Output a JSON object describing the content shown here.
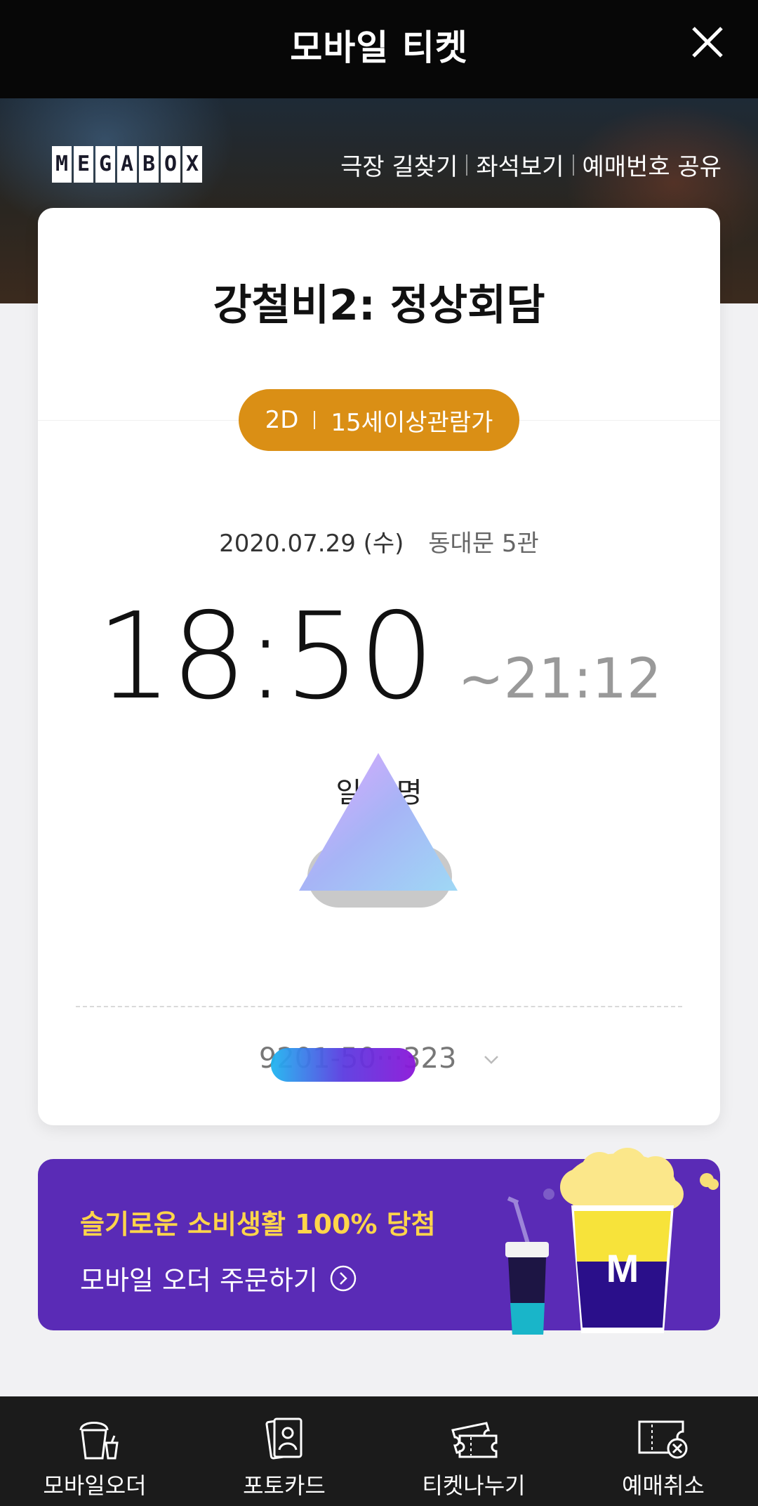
{
  "header": {
    "title": "모바일 티켓"
  },
  "hero": {
    "logo_letters": [
      "M",
      "E",
      "G",
      "A",
      "B",
      "O",
      "X"
    ],
    "links": [
      "극장 길찾기",
      "좌석보기",
      "예매번호 공유"
    ]
  },
  "ticket": {
    "movie_title": "강철비2: 정상회담",
    "format": "2D",
    "rating": "15세이상관람가",
    "date": "2020.07.29 (수)",
    "theater": "동대문 5관",
    "start_time": "18:50",
    "end_time": "~21:12",
    "people_label": "일반 명",
    "booking_number": "9201-50···323"
  },
  "promo": {
    "line1": "슬기로운 소비생활 100% 당첨",
    "line2": "모바일 오더 주문하기"
  },
  "bottom_nav": [
    {
      "label": "모바일오더",
      "icon": "popcorn-icon"
    },
    {
      "label": "포토카드",
      "icon": "photo-card-icon"
    },
    {
      "label": "티켓나누기",
      "icon": "ticket-share-icon"
    },
    {
      "label": "예매취소",
      "icon": "cancel-ticket-icon"
    }
  ],
  "colors": {
    "header_bg": "#070707",
    "badge": "#da8f15",
    "promo_bg": "#5a2bb6",
    "promo_accent": "#ffd54a",
    "nav_bg": "#1b1b1b"
  }
}
